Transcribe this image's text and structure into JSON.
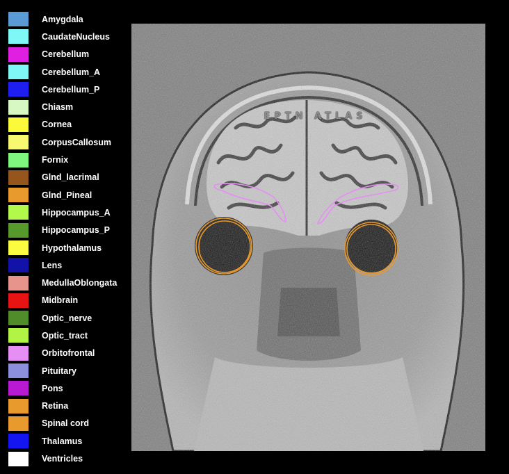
{
  "legend": {
    "items": [
      {
        "label": "Amygdala",
        "color": "#5b9bd5"
      },
      {
        "label": "CaudateNucleus",
        "color": "#7ff7f7"
      },
      {
        "label": "Cerebellum",
        "color": "#e020e0"
      },
      {
        "label": "Cerebellum_A",
        "color": "#7ff7f7"
      },
      {
        "label": "Cerebellum_P",
        "color": "#1e1ef0"
      },
      {
        "label": "Chiasm",
        "color": "#d7f8c3"
      },
      {
        "label": "Cornea",
        "color": "#fafa3a"
      },
      {
        "label": "CorpusCallosum",
        "color": "#f8f870"
      },
      {
        "label": "Fornix",
        "color": "#7ff77f"
      },
      {
        "label": "Glnd_lacrimal",
        "color": "#94561d"
      },
      {
        "label": "Glnd_Pineal",
        "color": "#e99a2c"
      },
      {
        "label": "Hippocampus_A",
        "color": "#b2f94b"
      },
      {
        "label": "Hippocampus_P",
        "color": "#559a2a"
      },
      {
        "label": "Hypothalamus",
        "color": "#fbfb42"
      },
      {
        "label": "Lens",
        "color": "#1312a8"
      },
      {
        "label": "MedullaOblongata",
        "color": "#e6948c"
      },
      {
        "label": "Midbrain",
        "color": "#e81414"
      },
      {
        "label": "Optic_nerve",
        "color": "#508d2a"
      },
      {
        "label": "Optic_tract",
        "color": "#b2f443"
      },
      {
        "label": "Orbitofrontal",
        "color": "#e58ef3"
      },
      {
        "label": "Pituitary",
        "color": "#8c8fdc"
      },
      {
        "label": "Pons",
        "color": "#b71ad0"
      },
      {
        "label": "Retina",
        "color": "#e99a2c"
      },
      {
        "label": "Spinal cord",
        "color": "#e99a2c"
      },
      {
        "label": "Thalamus",
        "color": "#1515f2"
      },
      {
        "label": "Ventricles",
        "color": "#ffffff"
      }
    ]
  },
  "image": {
    "watermark": "EPTN ATLAS",
    "contour_colors": {
      "orbitofrontal": "#e58ef3",
      "retina": "#e99a2c"
    }
  }
}
